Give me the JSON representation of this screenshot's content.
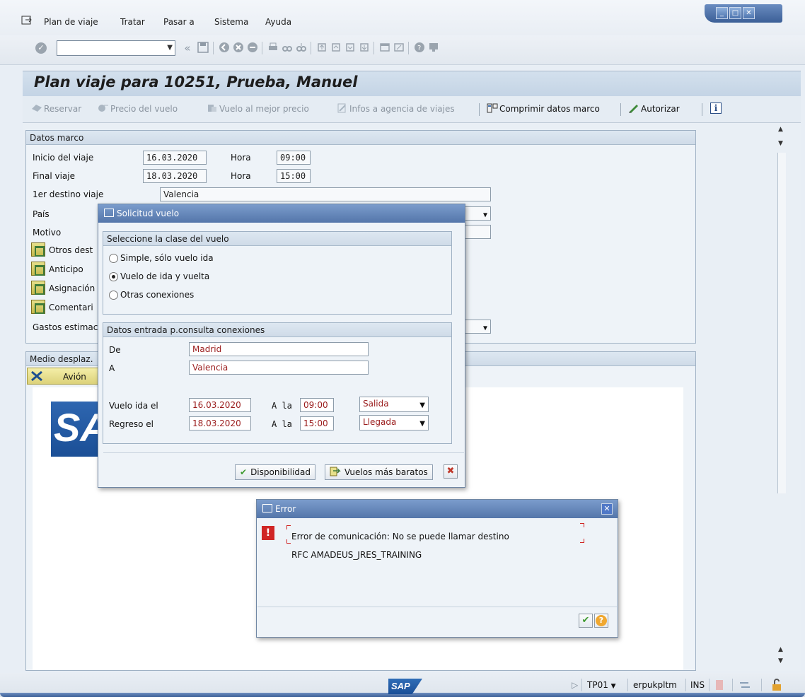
{
  "menu": {
    "items": [
      {
        "label": "Plan de viaje"
      },
      {
        "label": "Tratar"
      },
      {
        "label": "Pasar a"
      },
      {
        "label": "Sistema"
      },
      {
        "label": "Ayuda"
      }
    ]
  },
  "command_field": {
    "value": ""
  },
  "page": {
    "title": "Plan viaje para 10251, Prueba, Manuel"
  },
  "app_toolbar": {
    "reservar": "Reservar",
    "precio_vuelo": "Precio del vuelo",
    "vuelo_mejor_precio": "Vuelo al mejor precio",
    "infos_agencia": "Infos a agencia de viajes",
    "comprimir": "Comprimir datos marco",
    "autorizar": "Autorizar"
  },
  "datos_marco": {
    "title": "Datos marco",
    "inicio_label": "Inicio del viaje",
    "inicio_value": "16.03.2020",
    "hora_label": "Hora",
    "inicio_hora": "09:00",
    "final_label": "Final viaje",
    "final_value": "18.03.2020",
    "final_hora": "15:00",
    "destino_label": "1er destino viaje",
    "destino_value": "Valencia",
    "pais_label": "País",
    "motivo_label": "Motivo",
    "otros_dest": "Otros dest",
    "anticipo": "Anticipo",
    "asignacion": "Asignación",
    "comentario": "Comentari",
    "gastos": "Gastos estimac"
  },
  "medio": {
    "title": "Medio desplaz.",
    "avion": "Avión"
  },
  "solicitud": {
    "title": "Solicitud vuelo",
    "clase_title": "Seleccione la clase del vuelo",
    "options": [
      {
        "label": "Simple, sólo vuelo ida",
        "selected": false
      },
      {
        "label": "Vuelo de ida y vuelta",
        "selected": true
      },
      {
        "label": "Otras conexiones",
        "selected": false
      }
    ],
    "datos_title": "Datos entrada p.consulta conexiones",
    "de_label": "De",
    "de_value": "Madrid",
    "a_label": "A",
    "a_value": "Valencia",
    "ida_label": "Vuelo ida el",
    "ida_fecha": "16.03.2020",
    "ala_label": "A la",
    "ida_hora": "09:00",
    "ida_tipo": "Salida",
    "regreso_label": "Regreso el",
    "regreso_fecha": "18.03.2020",
    "regreso_hora": "15:00",
    "regreso_tipo": "Llegada",
    "disponibilidad": "Disponibilidad",
    "baratos": "Vuelos más baratos"
  },
  "error": {
    "title": "Error",
    "line1": "Error de comunicación: No se puede llamar destino",
    "line2": "RFC AMADEUS_JRES_TRAINING"
  },
  "status": {
    "logo": "SAP",
    "system": "TP01",
    "server": "erpukpltm",
    "mode": "INS"
  },
  "colors": {
    "title_bar": "#5476aa",
    "field_red_text": "#9a1b1b",
    "sap_blue": "#1b4f96"
  }
}
